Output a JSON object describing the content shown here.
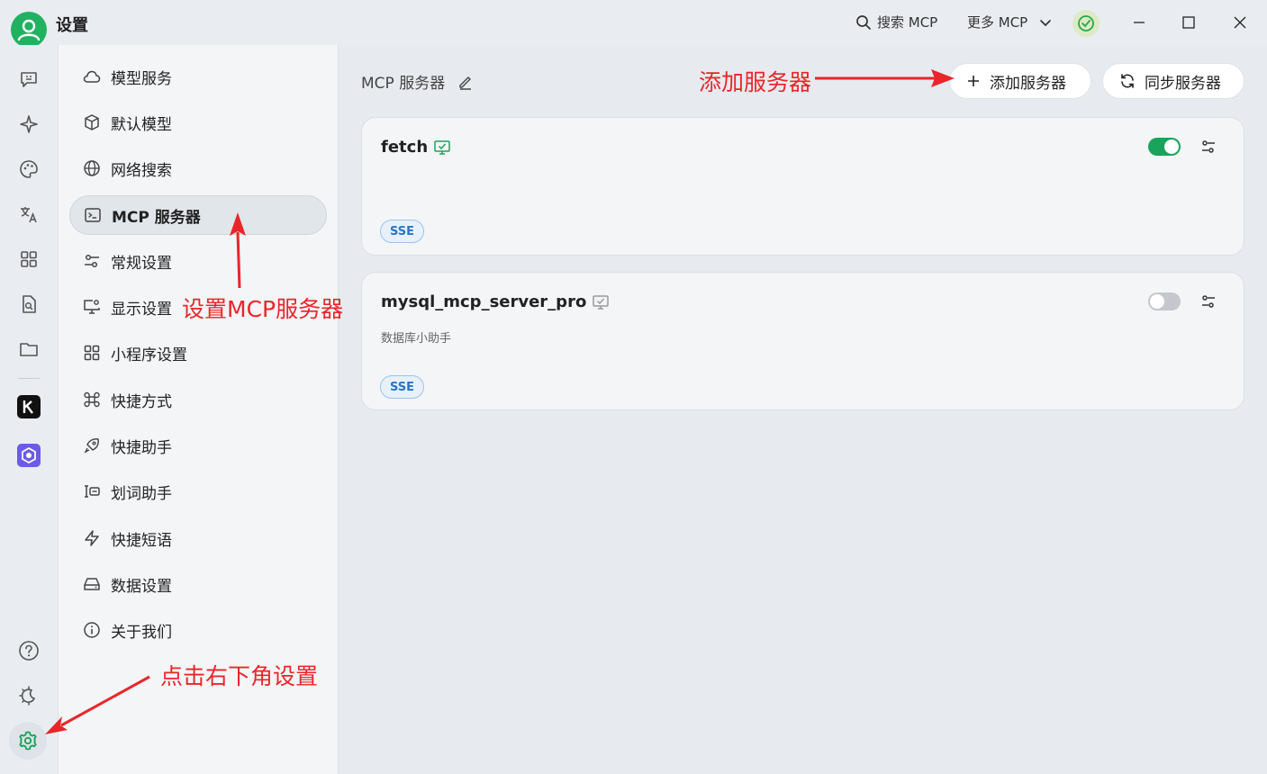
{
  "window": {
    "title": "设置",
    "search_label": "搜索 MCP",
    "more_label": "更多 MCP"
  },
  "rail": {
    "icons": [
      "chat-icon",
      "sparkle-icon",
      "palette-icon",
      "translate-icon",
      "apps-grid-icon",
      "document-search-icon",
      "folder-icon"
    ],
    "apps": [
      {
        "name": "k-app",
        "letter": "K",
        "color": "#111111"
      },
      {
        "name": "purple-app",
        "letter": "",
        "color": "#6b5ce7"
      }
    ],
    "bottom_icons": [
      "help-icon",
      "theme-icon",
      "settings-icon"
    ]
  },
  "sidebar": {
    "items": [
      {
        "label": "模型服务",
        "icon": "cloud-icon"
      },
      {
        "label": "默认模型",
        "icon": "cube-icon"
      },
      {
        "label": "网络搜索",
        "icon": "globe-icon"
      },
      {
        "label": "MCP 服务器",
        "icon": "terminal-icon",
        "active": true
      },
      {
        "label": "常规设置",
        "icon": "sliders-icon"
      },
      {
        "label": "显示设置",
        "icon": "monitor-gear-icon"
      },
      {
        "label": "小程序设置",
        "icon": "grid-icon"
      },
      {
        "label": "快捷方式",
        "icon": "command-icon"
      },
      {
        "label": "快捷助手",
        "icon": "rocket-icon"
      },
      {
        "label": "划词助手",
        "icon": "text-select-icon"
      },
      {
        "label": "快捷短语",
        "icon": "zap-icon"
      },
      {
        "label": "数据设置",
        "icon": "drive-icon"
      },
      {
        "label": "关于我们",
        "icon": "info-icon"
      }
    ]
  },
  "main": {
    "title": "MCP 服务器",
    "add_button": "添加服务器",
    "sync_button": "同步服务器",
    "servers": [
      {
        "name": "fetch",
        "description": "",
        "tag": "SSE",
        "enabled": true
      },
      {
        "name": "mysql_mcp_server_pro",
        "description": "数据库小助手",
        "tag": "SSE",
        "enabled": false
      }
    ]
  },
  "annotations": {
    "add_server": "添加服务器",
    "set_mcp": "设置MCP服务器",
    "click_settings": "点击右下角设置"
  },
  "colors": {
    "accent": "#1aa35a",
    "annotation": "#e8262a",
    "tag": "#2b74c6"
  }
}
